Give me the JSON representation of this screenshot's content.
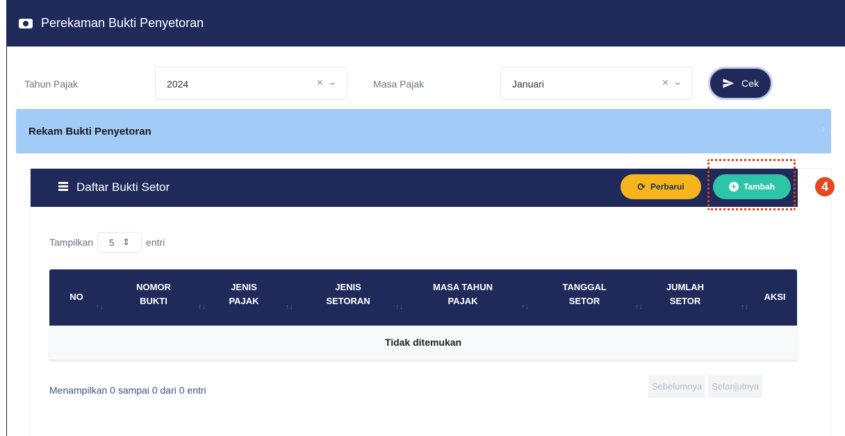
{
  "header": {
    "title": "Perekaman Bukti Penyetoran",
    "icon": "camera-icon"
  },
  "filters": {
    "tahun_label": "Tahun Pajak",
    "tahun_value": "2024",
    "masa_label": "Masa Pajak",
    "masa_value": "Januari",
    "cek_label": "Cek"
  },
  "section": {
    "title": "Rekam Bukti Penyetoran"
  },
  "card": {
    "title": "Daftar Bukti Setor",
    "perbarui_label": "Perbarui",
    "tambah_label": "Tambah",
    "step_number": "4"
  },
  "length": {
    "prefix": "Tampilkan",
    "value": "5",
    "suffix": "entri"
  },
  "table": {
    "columns": [
      {
        "line1": "NO",
        "line2": ""
      },
      {
        "line1": "NOMOR",
        "line2": "BUKTI"
      },
      {
        "line1": "JENIS",
        "line2": "PAJAK"
      },
      {
        "line1": "JENIS",
        "line2": "SETORAN"
      },
      {
        "line1": "MASA TAHUN",
        "line2": "PAJAK"
      },
      {
        "line1": "TANGGAL",
        "line2": "SETOR"
      },
      {
        "line1": "JUMLAH",
        "line2": "SETOR"
      },
      {
        "line1": "AKSI",
        "line2": ""
      }
    ],
    "empty_text": "Tidak ditemukan"
  },
  "footer": {
    "info": "Menampilkan 0 sampai 0 dari 0 entri",
    "prev_label": "Sebelumnya",
    "next_label": "Selanjutnya"
  },
  "colors": {
    "navy": "#1f2a5a",
    "banner": "#a3cbf7",
    "yellow": "#f6b51c",
    "teal": "#2ec4a8",
    "highlight": "#e03d1a"
  }
}
